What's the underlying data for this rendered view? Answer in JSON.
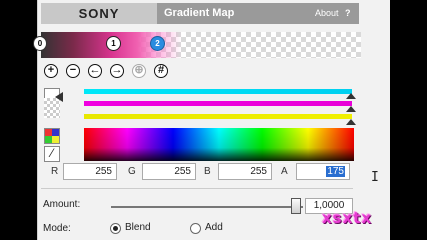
{
  "header": {
    "brand": "SONY",
    "title": "Gradient Map",
    "about": "About",
    "help": "?"
  },
  "gradient": {
    "stops": [
      "0",
      "1",
      "2"
    ],
    "colors": {
      "accent": "#d8348f",
      "selected_stop": "#2a8ce0"
    }
  },
  "toolbar": {
    "icons": [
      "add-stop-icon",
      "remove-stop-icon",
      "move-left-icon",
      "move-right-icon",
      "disabled-icon",
      "grid-icon"
    ],
    "glyphs": [
      "+",
      "−",
      "←",
      "→",
      "⊕",
      "#"
    ]
  },
  "color_bars": {
    "cyan": "#00e0f6",
    "magenta": "#f000e0",
    "yellow": "#ecec00"
  },
  "rgba": {
    "r_label": "R",
    "r_value": "255",
    "g_label": "G",
    "g_value": "255",
    "b_label": "B",
    "b_value": "255",
    "a_label": "A",
    "a_value": "175"
  },
  "amount": {
    "label": "Amount:",
    "value": "1,0000",
    "slider_fraction": 1.0
  },
  "mode": {
    "label": "Mode:",
    "options": [
      "Blend",
      "Add"
    ],
    "selected": "Blend"
  },
  "watermark": {
    "text": "xsxtx"
  }
}
